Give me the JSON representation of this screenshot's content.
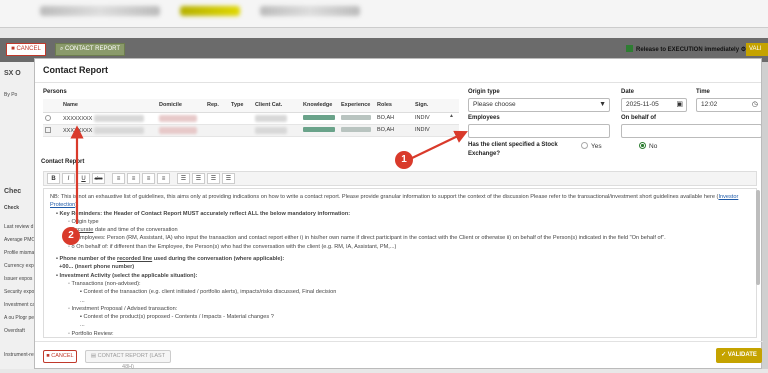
{
  "background": {
    "cancel_label": "CANCEL",
    "contact_report_label": "CONTACT REPORT",
    "release_label": "Release to EXECUTION immediately",
    "validate_label": "VALI",
    "side_items": [
      "SX O",
      "By Po",
      "Chec",
      "Check",
      "Last review d",
      "Average PMC",
      "Profile mismat",
      "Currency expo",
      "Issuer expos",
      "Security expo",
      "Investment ca",
      "A ou Plogr pe",
      "Overdraft",
      "Instrument-re"
    ]
  },
  "modal": {
    "title": "Contact Report",
    "persons_label": "Persons",
    "table": {
      "headers": [
        "Name",
        "Domicile",
        "Rep.",
        "Type",
        "Client Cat.",
        "Knowledge",
        "Experience",
        "Roles",
        "Sign."
      ],
      "rows": [
        {
          "name": "XXXXXXXX",
          "roles": "BO,AH",
          "sign": "INDIV"
        },
        {
          "name": "XXXXXXXX",
          "roles": "BO,AH",
          "sign": "INDIV"
        }
      ]
    },
    "origin_type": {
      "label": "Origin type",
      "value": "Please choose"
    },
    "date": {
      "label": "Date",
      "value": "2025-11-05"
    },
    "time": {
      "label": "Time",
      "value": "12:02"
    },
    "employees": {
      "label": "Employees",
      "value": ""
    },
    "on_behalf": {
      "label": "On behalf of",
      "value": ""
    },
    "stock_exchange": {
      "question": "Has the client specified a Stock Exchange?",
      "yes_label": "Yes",
      "no_label": "No",
      "selected": "No"
    },
    "contact_report_label": "Contact Report",
    "toolbar": {
      "bold": "B",
      "italic": "I",
      "underline": "U",
      "strike": "abc"
    },
    "editor": {
      "intro_a": "NB: This is not an exhaustive list of guidelines, this aims only at providing indications on how to write a contact report. Please provide granular information to support the context of the discussion Please refer to the transactional/investment short guidelines available",
      "intro_b": "here (",
      "intro_link": "Investor Protection",
      "intro_c": ").",
      "key_reminders": "Key Reminders: the Header of Contact Report MUST accurately reflect ALL the below mandatory information:",
      "origin_type": "Origin type",
      "accurate_pre": "",
      "accurate_u": "Accurate",
      "accurate_post": " date and time of the conversation",
      "employees_line": "o Employees: Person (RM, Assistant, IA) who input the transaction and contact report either i) in his/her own name if direct participant in the contact with the Client or otherwise ii) on behalf of the Person(s) indicated in the field \"On behalf of\".",
      "on_behalf_line": "o On behalf of: if different than the Employee, the Person(s) who had the conversation with the client (e.g. RM, IA, Assistant, PM,...)",
      "phone_pre": "Phone number of the ",
      "phone_u": "recorded line",
      "phone_post": " used during the conversation (where applicable):",
      "phone_value": "+00... (insert phone number)",
      "investment_activity": "Investment Activity (select the applicable situation):",
      "transactions": "Transactions (non-advised):",
      "transactions_ctx": "Context of the transaction (e.g. client initiated / portfolio alerts), impacts/risks discussed, Final decision",
      "ellipsis1": "...",
      "proposal": "Investment Proposal / Advised transaction:",
      "proposal_ctx": "Context of the product(s) proposed - Contents / Impacts - Material changes ?",
      "ellipsis2": "...",
      "portfolio_review": "Portfolio Review:"
    },
    "footer": {
      "cancel_label": "CANCEL",
      "contact_report_label": "CONTACT REPORT (LAST 48H)",
      "validate_label": "VALIDATE"
    }
  },
  "annotations": {
    "badge1": "1",
    "badge2": "2"
  },
  "colors": {
    "accent_gold": "#c5a300",
    "danger_red": "#c0392b",
    "annotation_red": "#d93a2b",
    "knowledge_green": "#6aa38a"
  }
}
